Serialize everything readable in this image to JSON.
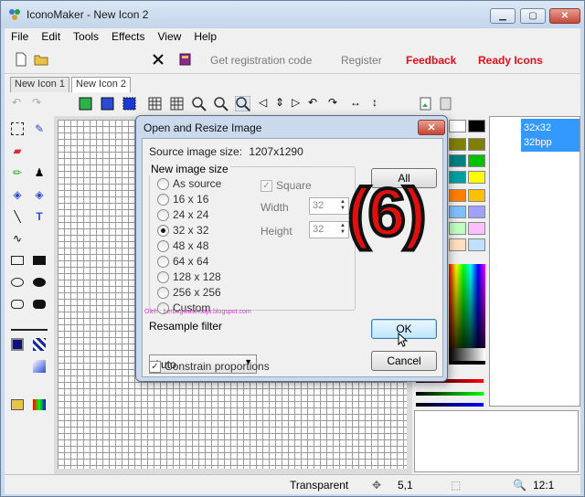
{
  "window": {
    "title": "IconoMaker - New Icon 2"
  },
  "menu": [
    "File",
    "Edit",
    "Tools",
    "Effects",
    "View",
    "Help"
  ],
  "toolbar": {
    "get_registration": "Get registration code",
    "register": "Register",
    "feedback": "Feedback",
    "ready_icons": "Ready Icons"
  },
  "tabs": [
    "New Icon 1",
    "New Icon 2"
  ],
  "format_list": {
    "size": "32x32",
    "depth": "32bpp"
  },
  "dialog": {
    "title": "Open and Resize Image",
    "source_size_label": "Source image size:",
    "source_size_value": "1207x1290",
    "group_label": "New image size",
    "options": [
      "As source",
      "16 x 16",
      "24 x 24",
      "32 x 32",
      "48 x 48",
      "64 x 64",
      "128 x 128",
      "256 x 256",
      "Custom"
    ],
    "selected_option": "32 x 32",
    "square_label": "Square",
    "width_label": "Width",
    "width_value": "32",
    "height_label": "Height",
    "height_value": "32",
    "all_button": "All",
    "resample_label": "Resample filter",
    "resample_value": "Auto",
    "constrain_label": "Constrain proportions",
    "ok_button": "OK",
    "cancel_button": "Cancel"
  },
  "annotation": "(6)",
  "watermark": "Oleh : berbagikasihsaja.blogspot.com",
  "status": {
    "transparent": "Transparent",
    "coords": "5,1",
    "zoom": "12:1"
  },
  "colors": {
    "accent_red": "#e0101a",
    "selection_blue": "#3399ff"
  }
}
